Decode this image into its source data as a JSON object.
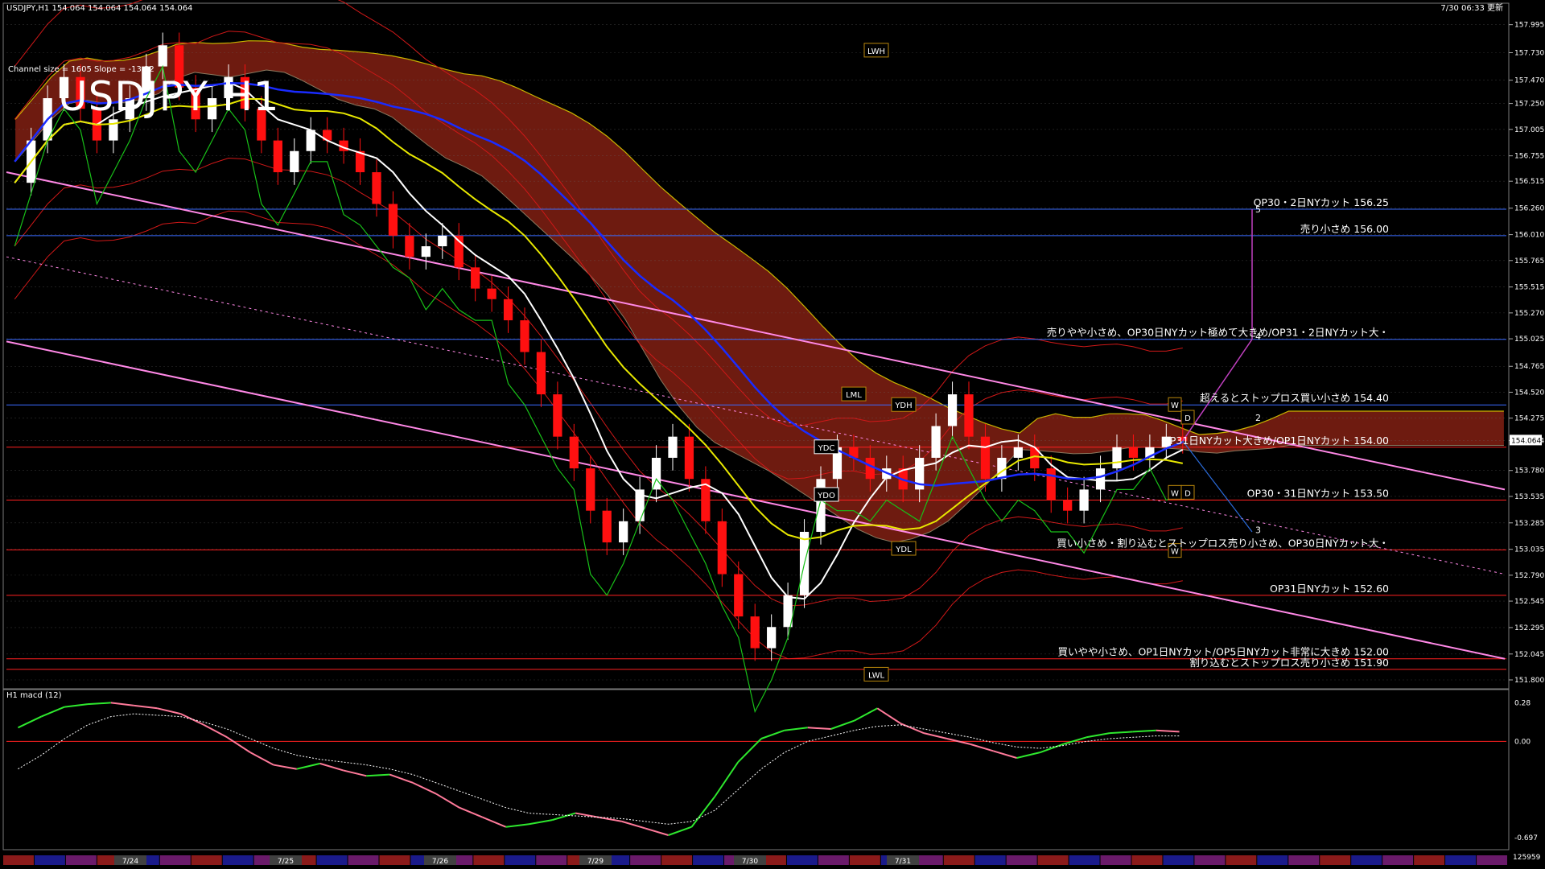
{
  "header": {
    "symbol_info": "USDJPY,H1  154.064 154.064 154.064 154.064",
    "datetime": "7/30 06:33 更新",
    "channel_info": "Channel size = 1605 Slope = -13.32",
    "big_title": "USDJPY H1"
  },
  "chart_data": [
    {
      "type": "line",
      "title": "USDJPY H1",
      "y_axis_ticks": [
        "157.995",
        "157.730",
        "157.470",
        "157.250",
        "157.005",
        "156.755",
        "156.515",
        "156.260",
        "156.010",
        "155.765",
        "155.515",
        "155.270",
        "155.025",
        "154.765",
        "154.520",
        "154.275",
        "154.064",
        "153.780",
        "153.535",
        "153.285",
        "153.035",
        "152.790",
        "152.545",
        "152.295",
        "152.045",
        "151.800"
      ],
      "current_price": "154.064",
      "ylim": [
        151.8,
        158.0
      ],
      "x_labels": [
        "7/24",
        "7/25",
        "7/26",
        "7/29",
        "7/30",
        "7/31"
      ],
      "horizontal_levels": [
        {
          "price": 156.25,
          "color": "#3a6bff",
          "label": "OP30・2日NYカット 156.25"
        },
        {
          "price": 156.0,
          "color": "#3a6bff",
          "label": "売り小さめ 156.00"
        },
        {
          "price": 155.02,
          "color": "#3a6bff",
          "label": "売りやや小さめ、OP30日NYカット極めて大きめ/OP31・2日NYカット大・"
        },
        {
          "price": 154.4,
          "color": "#3a6bff",
          "label": "超えるとストップロス買い小さめ 154.40"
        },
        {
          "price": 154.0,
          "color": "#ff2020",
          "label": "OP31日NYカット大きめ/OP1日NYカット 154.00"
        },
        {
          "price": 153.5,
          "color": "#ff2020",
          "label": "OP30・31日NYカット 153.50"
        },
        {
          "price": 153.03,
          "color": "#ff2020",
          "label": "買い小さめ・割り込むとストップロス売り小さめ、OP30日NYカット大・"
        },
        {
          "price": 152.6,
          "color": "#ff2020",
          "label": "OP31日NYカット 152.60"
        },
        {
          "price": 152.0,
          "color": "#ff2020",
          "label": "買いやや小さめ、OP1日NYカット/OP5日NYカット非常に大きめ 152.00"
        },
        {
          "price": 151.9,
          "color": "#ff2020",
          "label": "割り込むとストップロス売り小さめ 151.90"
        }
      ],
      "scenario_labels": [
        "5",
        "4",
        "2",
        "3"
      ],
      "level_boxes": [
        "LWH",
        "LWL",
        "YDH",
        "YDL",
        "YDC",
        "YDO",
        "LML",
        "W",
        "D",
        "W",
        "D",
        "W"
      ],
      "series": [
        {
          "name": "close",
          "color": "#ffffff",
          "values": [
            156.5,
            156.9,
            157.3,
            157.5,
            157.2,
            156.9,
            157.1,
            157.3,
            157.6,
            157.8,
            157.4,
            157.1,
            157.3,
            157.5,
            157.2,
            156.9,
            156.6,
            156.8,
            157.0,
            156.9,
            156.8,
            156.6,
            156.3,
            156.0,
            155.8,
            155.9,
            156.0,
            155.7,
            155.5,
            155.4,
            155.2,
            154.9,
            154.5,
            154.1,
            153.8,
            153.4,
            153.1,
            153.3,
            153.6,
            153.9,
            154.1,
            153.7,
            153.3,
            152.8,
            152.4,
            152.1,
            152.3,
            152.6,
            153.2,
            153.7,
            154.0,
            153.9,
            153.7,
            153.8,
            153.6,
            153.9,
            154.2,
            154.5,
            154.1,
            153.7,
            153.9,
            154.0,
            153.8,
            153.5,
            153.4,
            153.6,
            153.8,
            154.0,
            153.9,
            154.0,
            154.1,
            154.06
          ]
        }
      ],
      "colors": {
        "up": "#ffffff",
        "down": "#ff1010",
        "kumo": "#c8321e",
        "ma_yellow": "#e8e800",
        "ma_blue": "#1a2bff",
        "ma_white": "#ffffff",
        "chikou": "#18c018",
        "bands": "#d01818",
        "channel": "#ff88e6"
      }
    },
    {
      "type": "line",
      "title": "H1 macd (12)",
      "y_axis_ticks": [
        "0.28",
        "0.00",
        "-0.697"
      ],
      "ylim": [
        -0.75,
        0.3
      ],
      "series": [
        {
          "name": "macd",
          "values": [
            0.1,
            0.18,
            0.25,
            0.27,
            0.28,
            0.26,
            0.24,
            0.2,
            0.12,
            0.03,
            -0.08,
            -0.17,
            -0.2,
            -0.16,
            -0.21,
            -0.25,
            -0.24,
            -0.3,
            -0.38,
            -0.48,
            -0.55,
            -0.62,
            -0.6,
            -0.57,
            -0.52,
            -0.55,
            -0.58,
            -0.63,
            -0.68,
            -0.62,
            -0.4,
            -0.15,
            0.02,
            0.08,
            0.1,
            0.09,
            0.15,
            0.24,
            0.13,
            0.06,
            0.02,
            -0.02,
            -0.07,
            -0.12,
            -0.08,
            -0.02,
            0.03,
            0.06,
            0.07,
            0.08,
            0.07
          ]
        },
        {
          "name": "signal",
          "values": [
            -0.2,
            -0.1,
            0.02,
            0.12,
            0.18,
            0.2,
            0.19,
            0.18,
            0.14,
            0.09,
            0.02,
            -0.05,
            -0.1,
            -0.13,
            -0.15,
            -0.17,
            -0.2,
            -0.24,
            -0.3,
            -0.36,
            -0.42,
            -0.48,
            -0.52,
            -0.53,
            -0.54,
            -0.55,
            -0.56,
            -0.58,
            -0.6,
            -0.58,
            -0.5,
            -0.35,
            -0.2,
            -0.08,
            0.0,
            0.04,
            0.08,
            0.11,
            0.12,
            0.09,
            0.06,
            0.03,
            -0.01,
            -0.04,
            -0.05,
            -0.03,
            0.0,
            0.02,
            0.03,
            0.04,
            0.04
          ]
        }
      ]
    }
  ],
  "macd_panel": {
    "label": "H1  macd (12)",
    "bottom_value": "125959"
  }
}
